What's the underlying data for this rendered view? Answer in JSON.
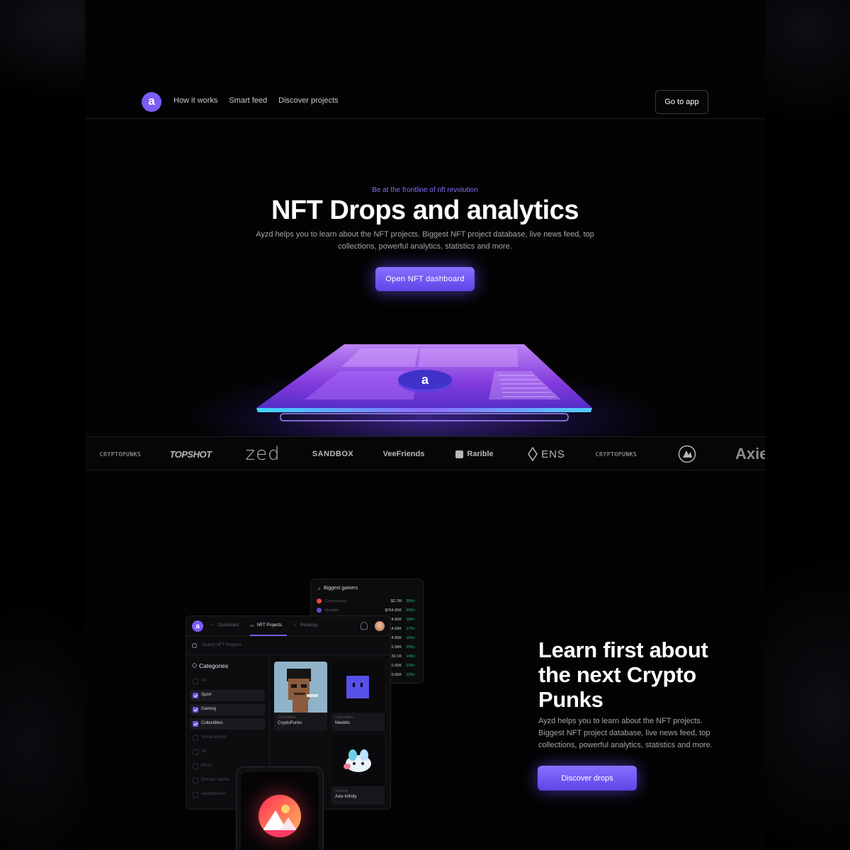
{
  "nav": {
    "logo_letter": "a",
    "links": [
      "How it works",
      "Smart feed",
      "Discover projects"
    ],
    "cta": "Go to app"
  },
  "hero": {
    "eyebrow": "Be at the frontline of nft revolution",
    "title": "NFT Drops and analytics",
    "description": "Ayzd helps you to learn about the NFT projects. Biggest NFT project database, live news feed, top collections, powerful analytics, statistics and more.",
    "cta": "Open NFT dashboard"
  },
  "partners": [
    "CRYPTOPUNKS",
    "TOPSHOT",
    "zed",
    "SANDBOX",
    "VeeFriends",
    "Rarible",
    "ENS",
    "CRYPTOPUNKS",
    "",
    "Axie"
  ],
  "learn": {
    "title": "Learn first about the next Crypto Punks",
    "description": "Ayzd helps you to learn about the NFT projects. Biggest NFT project database, live news feed, top collections, powerful analytics, statistics and more.",
    "cta": "Discover drops"
  },
  "gainers": {
    "title": "Biggest gainers",
    "rows": [
      {
        "name": "Cryptopunks",
        "value": "$2.7M",
        "pct": "25%",
        "color": "#e94b3c"
      },
      {
        "name": "Meebits",
        "value": "$764.65K",
        "pct": "20%",
        "color": "#5b50d6"
      },
      {
        "name": "",
        "value": "$544.65K",
        "pct": "18%",
        "color": ""
      },
      {
        "name": "",
        "value": "$434.68K",
        "pct": "17%",
        "color": ""
      },
      {
        "name": "",
        "value": "$224.65K",
        "pct": "16%",
        "color": ""
      },
      {
        "name": "",
        "value": "$201.99K",
        "pct": "15%",
        "color": ""
      },
      {
        "name": "",
        "value": "$132.1K",
        "pct": "14%",
        "color": ""
      },
      {
        "name": "",
        "value": "$101.65K",
        "pct": "13%",
        "color": ""
      },
      {
        "name": "",
        "value": "$93.65K",
        "pct": "12%",
        "color": ""
      }
    ]
  },
  "app": {
    "logo_letter": "a",
    "tabs": [
      "Dashboard",
      "NFT Projects",
      "Rankings"
    ],
    "search_placeholder": "Search NFT Projects",
    "categories_title": "Categories",
    "categories": [
      {
        "label": "All",
        "checked": false
      },
      {
        "label": "Sport",
        "checked": true
      },
      {
        "label": "Gaming",
        "checked": true
      },
      {
        "label": "Collectibles",
        "checked": true
      },
      {
        "label": "Virtual worlds",
        "checked": false
      },
      {
        "label": "Art",
        "checked": false
      },
      {
        "label": "Music",
        "checked": false
      },
      {
        "label": "Domain names",
        "checked": false
      },
      {
        "label": "Marketplaces",
        "checked": false
      }
    ],
    "cards": [
      {
        "category": "Collectibles",
        "name": "CryptoPunks"
      },
      {
        "category": "Collectibles",
        "name": "Meebits"
      },
      {
        "category": "Gaming",
        "name": "Axie Infinity"
      }
    ]
  },
  "colors": {
    "accent": "#7b5cf5",
    "positive": "#25c871",
    "background": "#030303"
  }
}
